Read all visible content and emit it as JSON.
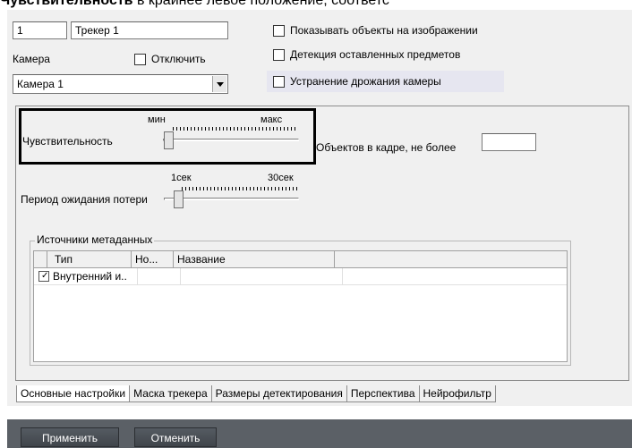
{
  "header_text": {
    "bold": "Чувствительность",
    "rest": " в крайнее левое положение, соответс"
  },
  "tracker": {
    "id": "1",
    "name": "Трекер 1"
  },
  "camera": {
    "label": "Камера",
    "disable_label": "Отключить",
    "selected": "Камера 1"
  },
  "options": {
    "show_objects": "Показывать объекты на изображении",
    "detect_left": "Детекция оставленных предметов",
    "stabilization": "Устранение дрожания камеры"
  },
  "sensitivity": {
    "label": "Чувствительность",
    "min_label": "мин",
    "max_label": "макс",
    "level": 0.0
  },
  "objects_limit": {
    "label": "Объектов в кадре, не более",
    "value": ""
  },
  "loss_period": {
    "label": "Период ожидания потери",
    "min_label": "1сек",
    "max_label": "30сек",
    "level": 0.0
  },
  "metadata": {
    "title": "Источники метаданных",
    "columns": [
      "Тип",
      "Но...",
      "Название"
    ],
    "rows": [
      {
        "checked": true,
        "type": "Внутренний и..",
        "num": "",
        "name": ""
      }
    ]
  },
  "tabs": [
    "Основные настройки",
    "Маска трекера",
    "Размеры детектирования",
    "Перспектива",
    "Нейрофильтр"
  ],
  "buttons": {
    "apply": "Применить",
    "cancel": "Отменить"
  },
  "colors": {
    "panel": "#f0f0f0",
    "footer": "#5b6066",
    "highlight": "#e6e6f0"
  }
}
